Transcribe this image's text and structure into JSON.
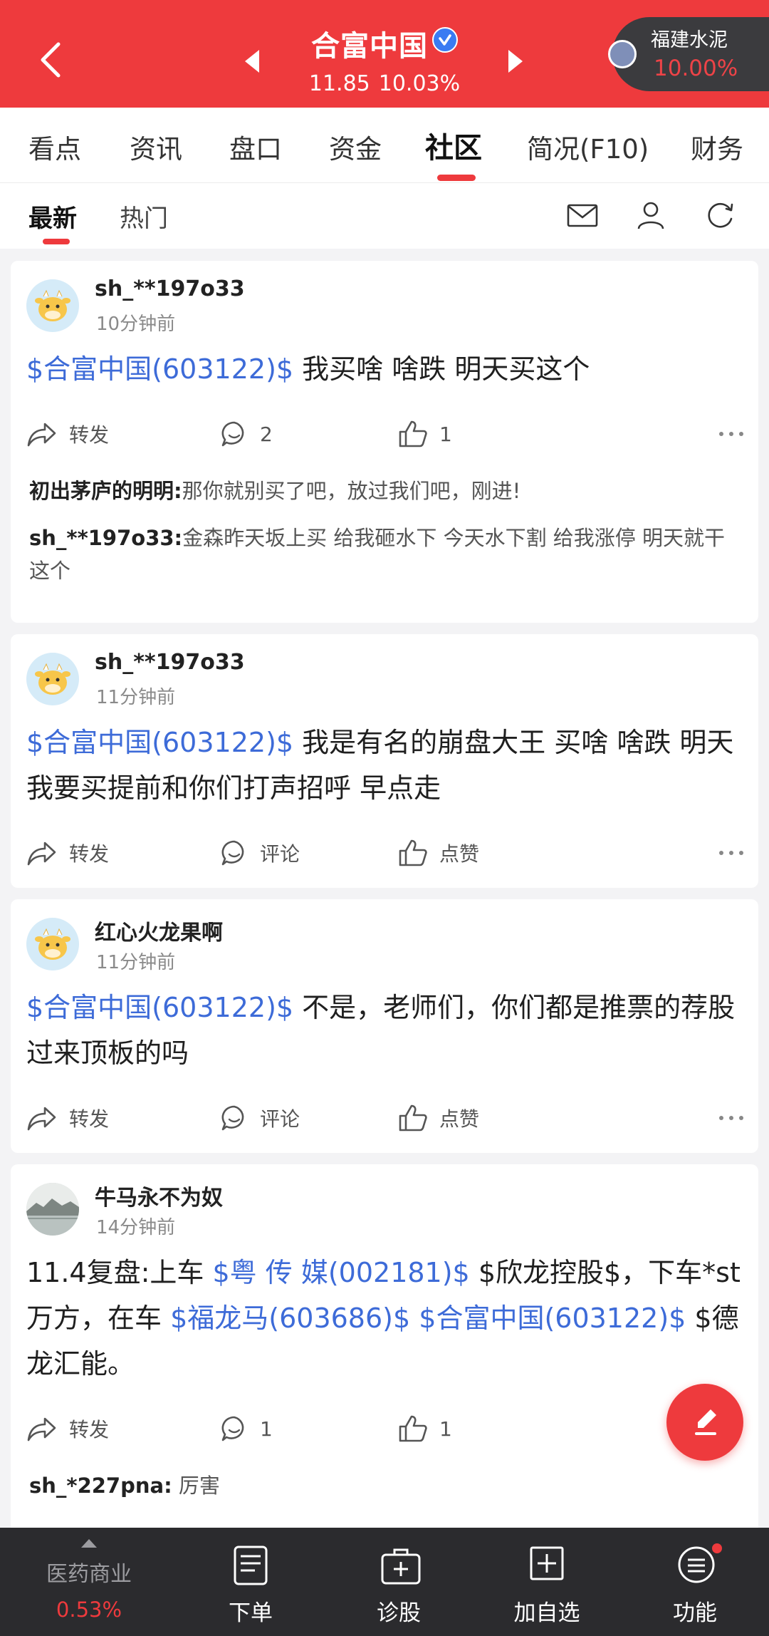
{
  "header": {
    "stock_name": "合富中国",
    "price": "11.85",
    "change_pct": "10.03%",
    "related_stock": {
      "name": "福建水泥",
      "change_pct": "10.00%"
    }
  },
  "main_tabs": [
    "看点",
    "资讯",
    "盘口",
    "资金",
    "社区",
    "简况(F10)",
    "财务"
  ],
  "active_main_tab": "社区",
  "sub_tabs": [
    "最新",
    "热门"
  ],
  "posts": [
    {
      "user": "sh_**197o33",
      "time": "10分钟前",
      "tag": "$合富中国(603122)$",
      "text": " 我买啥 啥跌 明天买这个",
      "repost": "转发",
      "comment": "2",
      "like": "1",
      "replies": [
        {
          "user": "初出茅庐的明明:",
          "text": "那你就别买了吧，放过我们吧，刚进!"
        },
        {
          "user": "sh_**197o33:",
          "text": "金森昨天坂上买 给我砸水下 今天水下割 给我涨停 明天就干这个"
        }
      ]
    },
    {
      "user": "sh_**197o33",
      "time": "11分钟前",
      "tag": "$合富中国(603122)$",
      "text": " 我是有名的崩盘大王 买啥 啥跌 明天我要买提前和你们打声招呼 早点走",
      "repost": "转发",
      "comment": "评论",
      "like": "点赞"
    },
    {
      "user": "红心火龙果啊",
      "time": "11分钟前",
      "tag": "$合富中国(603122)$",
      "text": " 不是，老师们，你们都是推票的荐股过来顶板的吗",
      "repost": "转发",
      "comment": "评论",
      "like": "点赞"
    },
    {
      "user": "牛马永不为奴",
      "time": "14分钟前",
      "segments": {
        "s1": "11.4复盘:上车 ",
        "t1": "$粤 传 媒(002181)$",
        "s2": " $欣龙控股$，下车*st万方，在车 ",
        "t2": "$福龙马(603686)$",
        "s3": " ",
        "t3": "$合富中国(603122)$",
        "s4": " $德龙汇能。"
      },
      "repost": "转发",
      "comment": "1",
      "like": "1",
      "replies": [
        {
          "user": "sh_*227pna:",
          "text": "厉害"
        }
      ]
    }
  ],
  "bottom_bar": {
    "sector_name": "医药商业",
    "sector_pct": "0.53%",
    "items": [
      "下单",
      "诊股",
      "加自选",
      "功能"
    ]
  },
  "colors": {
    "brand_red": "#ee3a3d",
    "link_blue": "#3d6bd8"
  }
}
